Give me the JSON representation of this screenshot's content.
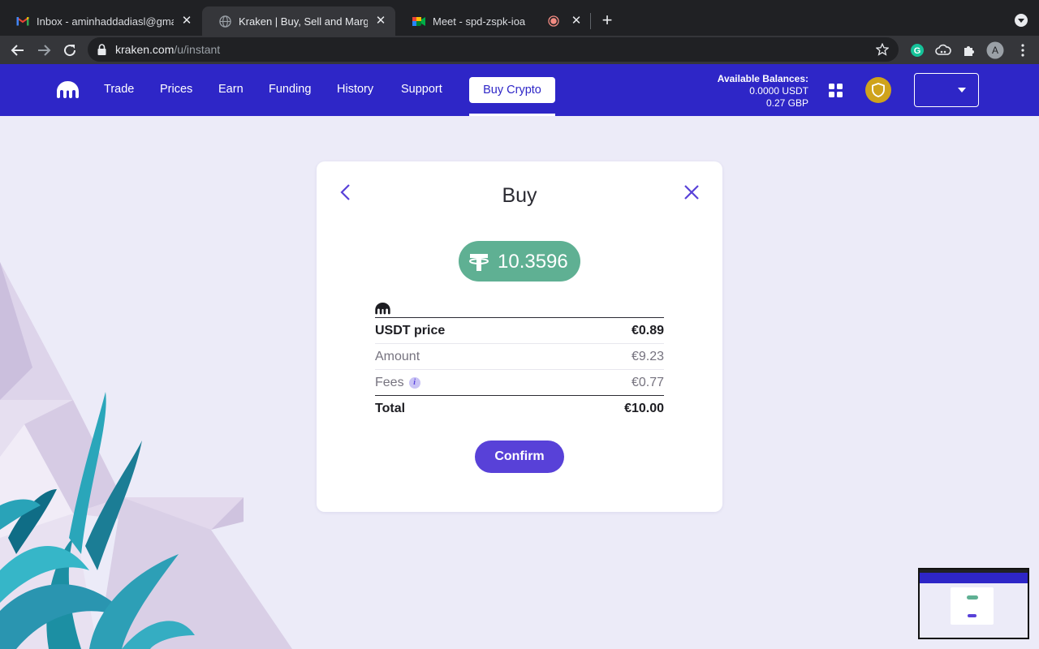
{
  "browser": {
    "tabs": [
      {
        "title": "Inbox - aminhaddadiasl@gmail",
        "favicon": "gmail-icon",
        "active": false
      },
      {
        "title": "Kraken | Buy, Sell and Margin T",
        "favicon": "globe-icon",
        "active": true
      },
      {
        "title": "Meet - spd-zspk-ioa",
        "favicon": "meet-icon",
        "active": false
      }
    ],
    "url_host": "kraken.com",
    "url_path": "/u/instant",
    "profile_initial": "A"
  },
  "nav": {
    "items": [
      "Trade",
      "Prices",
      "Earn",
      "Funding",
      "History",
      "Support"
    ],
    "buy_crypto": "Buy Crypto",
    "balances_title": "Available Balances:",
    "balance_usdt": "0.0000 USDT",
    "balance_gbp": "0.27 GBP"
  },
  "card": {
    "title": "Buy",
    "amount": "10.3596",
    "rows": {
      "price_label": "USDT price",
      "price_value": "€0.89",
      "amount_label": "Amount",
      "amount_value": "€9.23",
      "fees_label": "Fees",
      "fees_value": "€0.77",
      "total_label": "Total",
      "total_value": "€10.00"
    },
    "confirm": "Confirm",
    "info_glyph": "i"
  },
  "colors": {
    "brand": "#2e26c7",
    "accent": "#5841d8",
    "tether": "#5fb093",
    "page_bg": "#ecebf8"
  }
}
